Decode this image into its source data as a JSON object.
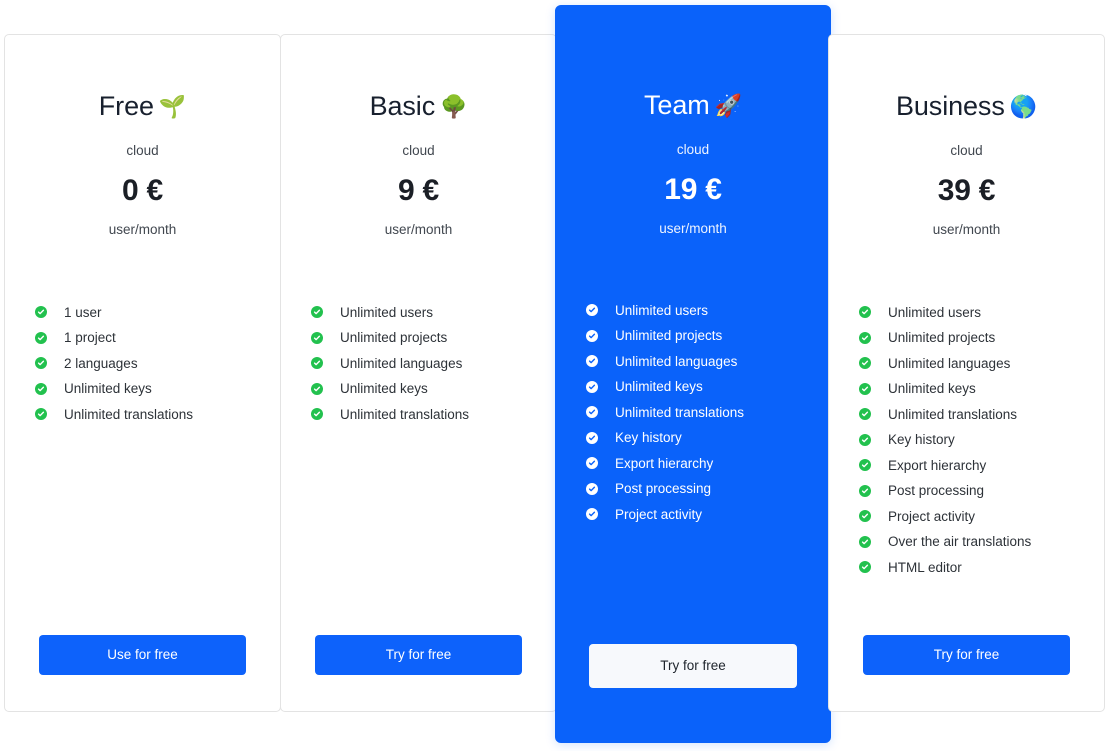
{
  "theme": {
    "accent_blue": "#0a62fa",
    "button_blue": "#0d62fb",
    "check_green": "#22c14e",
    "light_button_bg": "#f7f9fc",
    "card_border": "#e3e3e3"
  },
  "plans": [
    {
      "name": "Free",
      "emoji": "🌱",
      "emoji_name": "seedling-emoji",
      "hosting": "cloud",
      "price": "0 €",
      "period": "user/month",
      "featured": false,
      "cta": "Use for free",
      "features": [
        "1 user",
        "1 project",
        "2 languages",
        "Unlimited keys",
        "Unlimited translations"
      ]
    },
    {
      "name": "Basic",
      "emoji": "🌳",
      "emoji_name": "tree-emoji",
      "hosting": "cloud",
      "price": "9 €",
      "period": "user/month",
      "featured": false,
      "cta": "Try for free",
      "features": [
        "Unlimited users",
        "Unlimited projects",
        "Unlimited languages",
        "Unlimited keys",
        "Unlimited translations"
      ]
    },
    {
      "name": "Team",
      "emoji": "🚀",
      "emoji_name": "rocket-emoji",
      "hosting": "cloud",
      "price": "19 €",
      "period": "user/month",
      "featured": true,
      "cta": "Try for free",
      "features": [
        "Unlimited users",
        "Unlimited projects",
        "Unlimited languages",
        "Unlimited keys",
        "Unlimited translations",
        "Key history",
        "Export hierarchy",
        "Post processing",
        "Project activity"
      ]
    },
    {
      "name": "Business",
      "emoji": "🌎",
      "emoji_name": "globe-emoji",
      "hosting": "cloud",
      "price": "39 €",
      "period": "user/month",
      "featured": false,
      "cta": "Try for free",
      "features": [
        "Unlimited users",
        "Unlimited projects",
        "Unlimited languages",
        "Unlimited keys",
        "Unlimited translations",
        "Key history",
        "Export hierarchy",
        "Post processing",
        "Project activity",
        "Over the air translations",
        "HTML editor"
      ]
    }
  ]
}
